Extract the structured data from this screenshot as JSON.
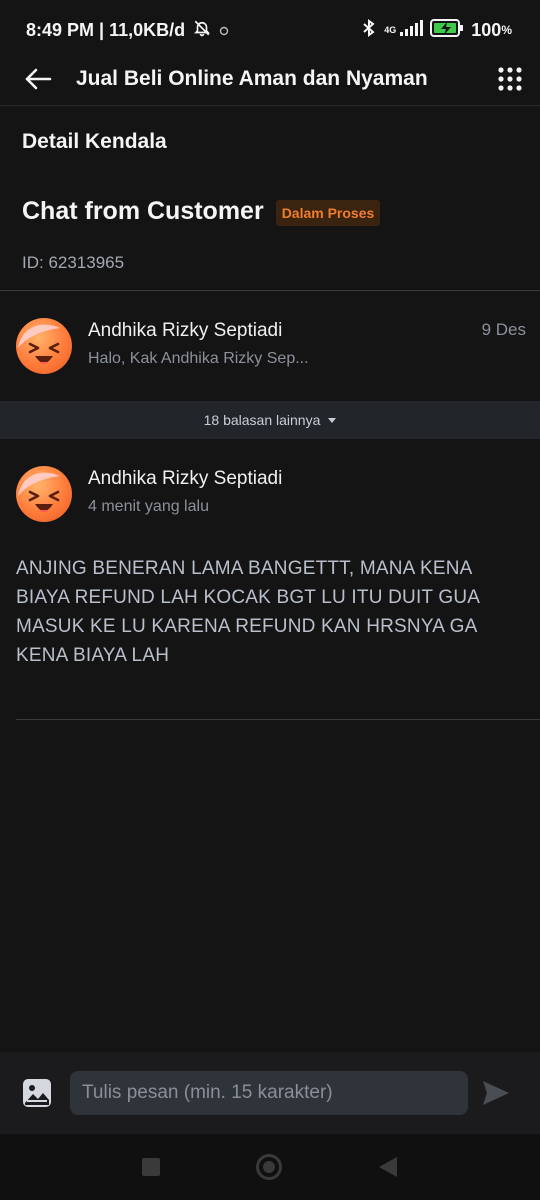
{
  "status_bar": {
    "time_and_speed": "8:49 PM | 11,0KB/d",
    "network_label": "4G",
    "battery": "100"
  },
  "app_bar": {
    "title": "Jual Beli Online Aman dan Nyaman",
    "back_icon": "arrow-left-icon",
    "menu_icon": "grid-dots-icon"
  },
  "page": {
    "section_title": "Detail Kendala",
    "chat_title": "Chat from Customer",
    "status_badge": "Dalam Proses",
    "ticket_id": "ID: 62313965"
  },
  "first_message": {
    "sender": "Andhika Rizky Septiadi",
    "preview": "Halo, Kak Andhika Rizky Sep...",
    "date": "9 Des"
  },
  "replies_toggle": "18 balasan lainnya",
  "latest_message": {
    "sender": "Andhika Rizky Septiadi",
    "time": "4 menit yang lalu",
    "text": "ANJING BENERAN LAMA BANGETTT, MANA KENA BIAYA REFUND LAH KOCAK BGT LU ITU DUIT GUA MASUK KE LU KARENA REFUND KAN HRSNYA GA KENA BIAYA LAH"
  },
  "composer": {
    "placeholder": "Tulis pesan (min. 15 karakter)",
    "value": ""
  },
  "colors": {
    "background": "#141414",
    "badge_text": "#f07d2d",
    "badge_bg": "#3a2410",
    "avatar": "#ff7b3a"
  }
}
